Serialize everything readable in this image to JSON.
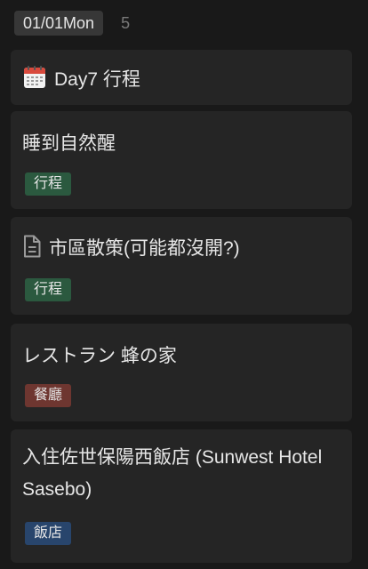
{
  "group": {
    "date": "01/01Mon",
    "count": "5"
  },
  "cards": [
    {
      "title": "Day7 行程",
      "icon": "calendar-icon"
    },
    {
      "title": "睡到自然醒",
      "tag": "行程",
      "tag_color": "#2b593f"
    },
    {
      "title": "市區散策(可能都沒開?)",
      "icon": "document-icon",
      "tag": "行程",
      "tag_color": "#2b593f"
    },
    {
      "title": "レストラン 蜂の家",
      "tag": "餐廳",
      "tag_color": "#6e3630"
    },
    {
      "title": "入住佐世保陽西飯店 (Sunwest Hotel Sasebo)",
      "tag": "飯店",
      "tag_color": "#28456c"
    }
  ]
}
